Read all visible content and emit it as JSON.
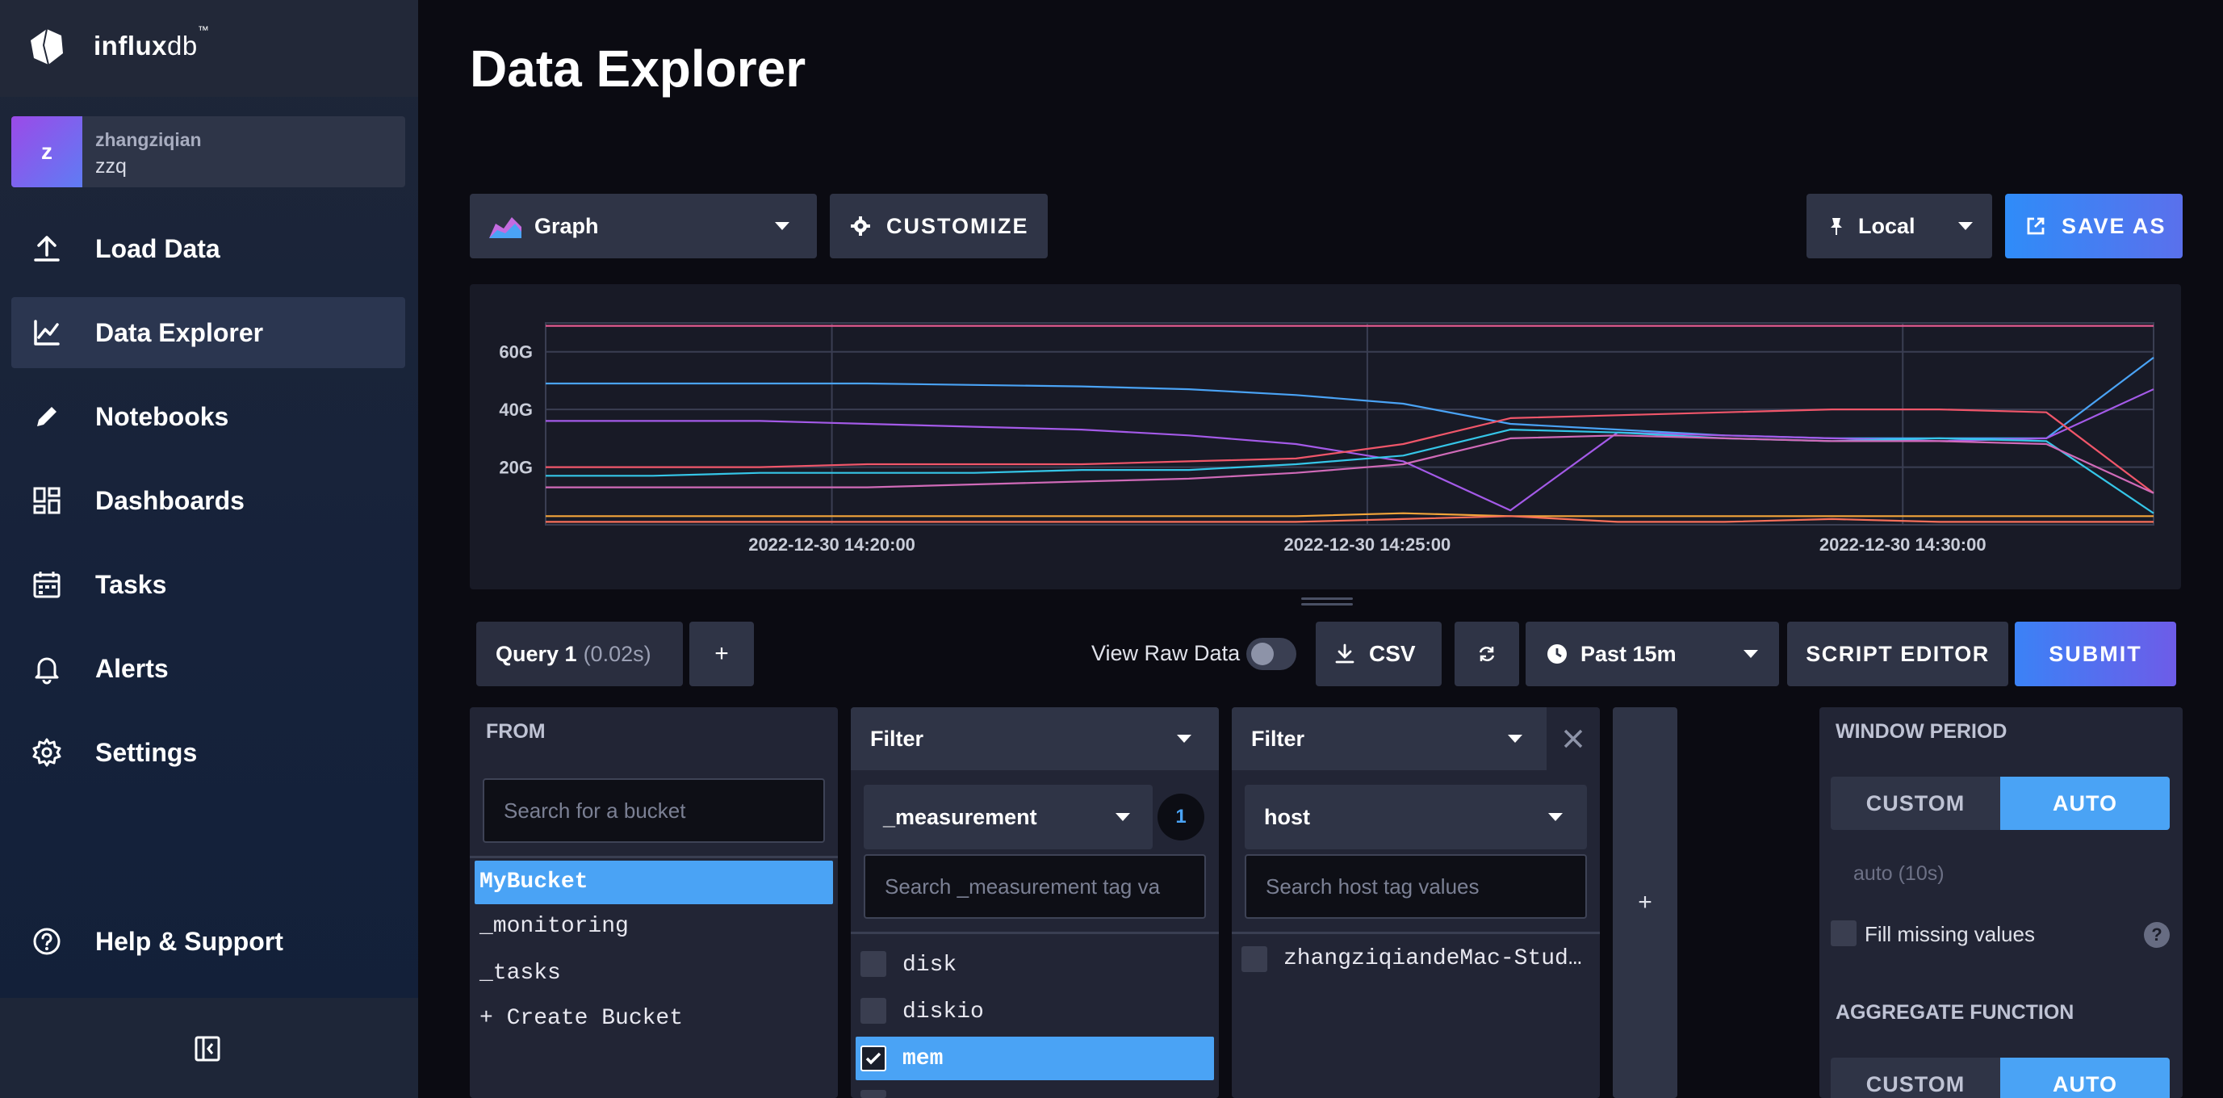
{
  "brand": {
    "name_bold": "influx",
    "name_light": "db",
    "tm": "™"
  },
  "user": {
    "avatar_letter": "z",
    "name": "zhangziqian",
    "org": "zzq"
  },
  "nav": {
    "load_data": "Load Data",
    "data_explorer": "Data Explorer",
    "notebooks": "Notebooks",
    "dashboards": "Dashboards",
    "tasks": "Tasks",
    "alerts": "Alerts",
    "settings": "Settings",
    "help": "Help & Support"
  },
  "page": {
    "title": "Data Explorer"
  },
  "toolbar": {
    "graph_type": "Graph",
    "customize": "CUSTOMIZE",
    "timezone": "Local",
    "save_as": "SAVE AS"
  },
  "chart_data": {
    "type": "line",
    "title": "",
    "xlabel": "",
    "ylabel": "",
    "x_ticks": [
      "2022-12-30 14:20:00",
      "2022-12-30 14:25:00",
      "2022-12-30 14:30:00"
    ],
    "y_ticks": [
      "20G",
      "40G",
      "60G"
    ],
    "ylim": [
      0,
      70
    ],
    "grid": true,
    "x": [
      0,
      1,
      2,
      3,
      4,
      5,
      6,
      7,
      8,
      9,
      10,
      11,
      12,
      13,
      14,
      15
    ],
    "series": [
      {
        "color": "#e35a8f",
        "values": [
          69,
          69,
          69,
          69,
          69,
          69,
          69,
          69,
          69,
          69,
          69,
          69,
          69,
          69,
          69,
          69
        ]
      },
      {
        "color": "#4aa3f5",
        "values": [
          49,
          49,
          49,
          49,
          48.5,
          48,
          47,
          45,
          42,
          35,
          33,
          31,
          30,
          30,
          30,
          58
        ]
      },
      {
        "color": "#a45ae8",
        "values": [
          36,
          36,
          36,
          35,
          34,
          33,
          31,
          28,
          22,
          5,
          32,
          31,
          30,
          29,
          30,
          47
        ]
      },
      {
        "color": "#f0566a",
        "values": [
          20,
          20,
          20,
          21,
          21,
          21,
          22,
          23,
          28,
          37,
          38,
          39,
          40,
          40,
          39,
          11
        ]
      },
      {
        "color": "#35c6e8",
        "values": [
          17,
          17,
          18,
          18,
          18,
          19,
          19,
          21,
          24,
          33,
          32,
          30,
          29,
          30,
          29,
          4
        ]
      },
      {
        "color": "#d06ab8",
        "values": [
          13,
          13,
          13,
          13,
          14,
          15,
          16,
          18,
          21,
          30,
          31,
          30,
          29,
          29,
          28,
          11
        ]
      },
      {
        "color": "#f3a53a",
        "values": [
          3,
          3,
          3,
          3,
          3,
          3,
          3,
          3,
          4,
          3,
          3,
          3,
          3,
          3,
          3,
          3
        ]
      },
      {
        "color": "#f8705a",
        "values": [
          1,
          1,
          1,
          1,
          1,
          1,
          1,
          1,
          2,
          3,
          1,
          1,
          2,
          1,
          1,
          1
        ]
      }
    ]
  },
  "query_bar": {
    "query_name": "Query 1",
    "query_time": "(0.02s)",
    "add": "+",
    "view_raw": "View Raw Data",
    "csv": "CSV",
    "time_range": "Past 15m",
    "script_editor": "SCRIPT EDITOR",
    "submit": "SUBMIT"
  },
  "from_panel": {
    "header": "FROM",
    "search_placeholder": "Search for a bucket",
    "buckets": [
      "MyBucket",
      "_monitoring",
      "_tasks"
    ],
    "create": "+ Create Bucket"
  },
  "filter1": {
    "header": "Filter",
    "key": "_measurement",
    "count": "1",
    "search_placeholder": "Search _measurement tag va",
    "values": [
      "disk",
      "diskio",
      "mem"
    ]
  },
  "filter2": {
    "header": "Filter",
    "key": "host",
    "search_placeholder": "Search host tag values",
    "values": [
      "zhangziqiandeMac-Stud…"
    ]
  },
  "add_filter": "+",
  "window_panel": {
    "header": "WINDOW PERIOD",
    "custom": "CUSTOM",
    "auto": "AUTO",
    "auto_value": "auto (10s)",
    "fill_missing": "Fill missing values",
    "help": "?",
    "agg_header": "AGGREGATE FUNCTION",
    "agg_custom": "CUSTOM",
    "agg_auto": "AUTO"
  }
}
